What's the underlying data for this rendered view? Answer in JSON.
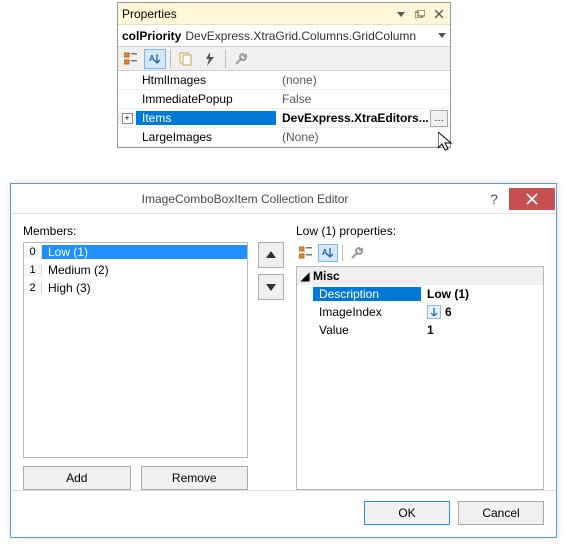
{
  "properties": {
    "title": "Properties",
    "object_name": "colPriority",
    "object_type": "DevExpress.XtraGrid.Columns.GridColumn",
    "rows": [
      {
        "name": "HtmlImages",
        "value": "(none)"
      },
      {
        "name": "ImmediatePopup",
        "value": "False"
      },
      {
        "name": "Items",
        "value": "DevExpress.XtraEditors..."
      },
      {
        "name": "LargeImages",
        "value": "(None)"
      }
    ],
    "selected": "Items"
  },
  "dialog": {
    "title": "ImageComboBoxItem Collection Editor",
    "members_label": "Members:",
    "members": [
      "Low (1)",
      "Medium (2)",
      "High (3)"
    ],
    "members_selected_index": 0,
    "add_label": "Add",
    "remove_label": "Remove",
    "right_label": "Low (1) properties:",
    "category": "Misc",
    "props": {
      "Description": "Low (1)",
      "ImageIndex": "6",
      "Value": "1"
    },
    "selected_prop": "Description",
    "ok_label": "OK",
    "cancel_label": "Cancel"
  }
}
